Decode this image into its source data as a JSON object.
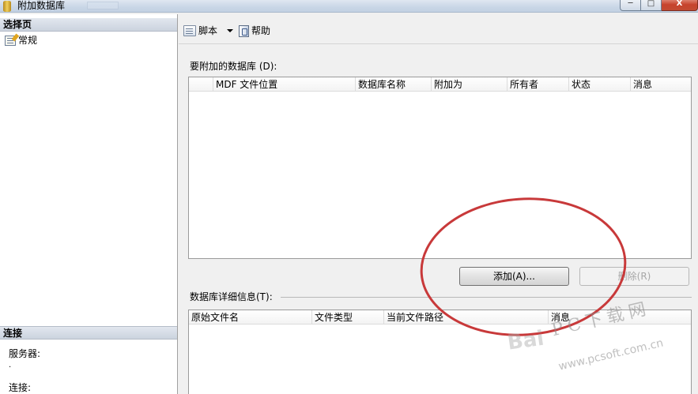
{
  "window": {
    "title": "附加数据库",
    "minimize_glyph": "",
    "maximize_glyph": "",
    "close_glyph": "X"
  },
  "left_pane": {
    "select_page_header": "选择页",
    "items": [
      {
        "label": "常规",
        "icon": "general-page-icon"
      }
    ],
    "connection_header": "连接",
    "server_label": "服务器:",
    "server_value": ".",
    "connection_label": "连接:"
  },
  "toolbar": {
    "script_label": "脚本",
    "script_icon": "script-icon",
    "help_label": "帮助",
    "help_icon": "help-icon"
  },
  "attach_section": {
    "label": "要附加的数据库 (D):",
    "columns": [
      "MDF 文件位置",
      "数据库名称",
      "附加为",
      "所有者",
      "状态",
      "消息"
    ],
    "rows": []
  },
  "buttons": {
    "add_label": "添加(A)...",
    "remove_label": "删除(R)",
    "remove_enabled": false
  },
  "details_section": {
    "label": "数据库详细信息(T):",
    "columns": [
      "原始文件名",
      "文件类型",
      "当前文件路径",
      "消息"
    ],
    "rows": []
  },
  "watermark": {
    "logo_text": "Bai",
    "site_name": "PC下载网",
    "url": "www.pcsoft.com.cn"
  },
  "colors": {
    "highlight_circle": "#c8393a",
    "header_gradient_top": "#e2e7ef",
    "header_gradient_bottom": "#cbd3de"
  }
}
